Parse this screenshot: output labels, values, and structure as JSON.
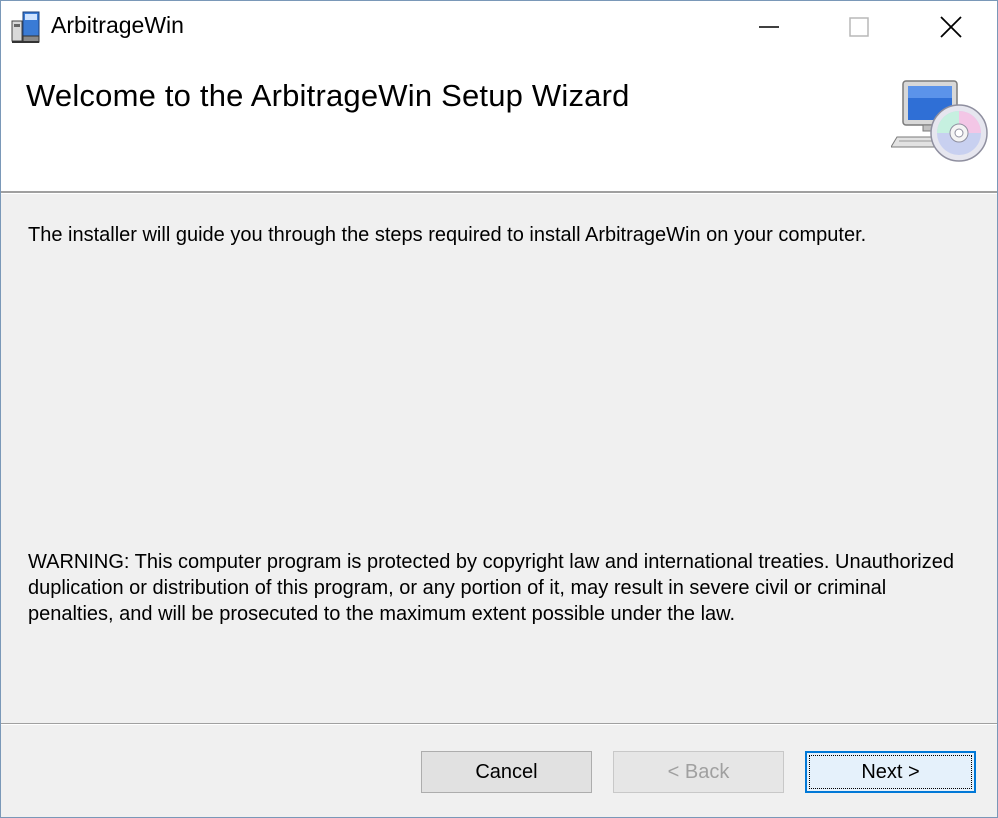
{
  "window": {
    "title": "ArbitrageWin",
    "app_icon": "installer-package-icon",
    "controls": [
      "minimize-icon",
      "maximize-icon",
      "close-icon"
    ]
  },
  "banner": {
    "title": "Welcome to the ArbitrageWin Setup Wizard",
    "graphic": "computer-cd-icon"
  },
  "content": {
    "intro": "The installer will guide you through the steps required to install ArbitrageWin on your computer.",
    "warning": "WARNING: This computer program is protected by copyright law and international treaties. Unauthorized duplication or distribution of this program, or any portion of it, may result in severe civil or criminal penalties, and will be prosecuted to the maximum extent possible under the law."
  },
  "buttons": {
    "cancel": "Cancel",
    "back": "< Back",
    "next": "Next >"
  },
  "colors": {
    "accent": "#0078d7",
    "window_bg": "#f0f0f0",
    "disabled_text": "#a0a0a0"
  }
}
